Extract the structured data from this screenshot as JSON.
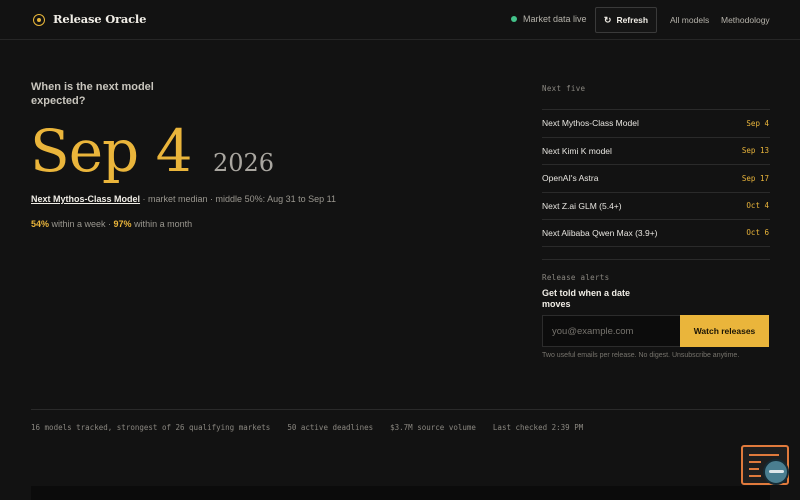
{
  "header": {
    "brand": "Release Oracle",
    "status_text": "Market data live",
    "refresh_label": "Refresh",
    "refresh_icon": "↻",
    "nav": [
      "All models",
      "Methodology"
    ]
  },
  "hero": {
    "question": "When is the next model expected?",
    "date": "Sep 4",
    "year": "2026",
    "model_link": "Next Mythos-Class Model",
    "meta_text": " · market median · middle 50%: Aug 31 to Sep 11",
    "week_pct": "54%",
    "week_text": " within a week · ",
    "month_pct": "97%",
    "month_text": " within a month"
  },
  "next_five": {
    "label": "Next five",
    "items": [
      {
        "name": "Next Mythos-Class Model",
        "date": "Sep 4"
      },
      {
        "name": "Next Kimi K model",
        "date": "Sep 13"
      },
      {
        "name": "OpenAI's Astra",
        "date": "Sep 17"
      },
      {
        "name": "Next Z.ai GLM (5.4+)",
        "date": "Oct 4"
      },
      {
        "name": "Next Alibaba Qwen Max (3.9+)",
        "date": "Oct 6"
      }
    ]
  },
  "alerts": {
    "label": "Release alerts",
    "title": "Get told when a date moves",
    "email_placeholder": "you@example.com",
    "button_label": "Watch releases",
    "note": "Two useful emails per release. No digest. Unsubscribe anytime."
  },
  "footer": {
    "stats": [
      "16 models tracked, strongest of 26 qualifying markets",
      "50 active deadlines",
      "$3.7M source volume",
      "Last checked 2:39 PM"
    ]
  },
  "colors": {
    "accent": "#eab53b",
    "live": "#43c28a",
    "background": "#121212"
  }
}
